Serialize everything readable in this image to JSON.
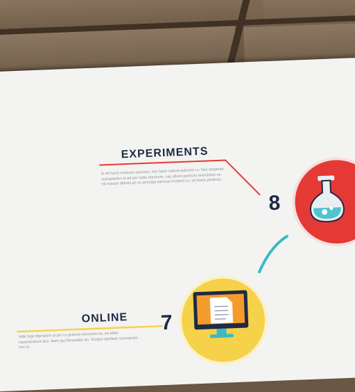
{
  "infographic": {
    "steps": [
      {
        "number": "8",
        "title": "EXPERIMENTS",
        "body": "In sit fusce sceaves auscium, nec facer natura aulumet cu. Nec stoperae suscipiantur et ad per radio donorum, cas ubore pertectu exercitatur ex. Vix fussse defcitu an ne principa sanctus incidunt cu, sit lorem perfecto.",
        "icon": "flask-icon",
        "color": "#e53935"
      },
      {
        "number": "7",
        "title": "ONLINE",
        "body": "Vide fugit dignissim ut pro cu graecis menandri ex, ea tollet reprehendunt duo. Nam qui Recusabo an. Scripta oporteat concepcion nec et.",
        "icon": "computer-icon",
        "color": "#f6d24a"
      }
    ],
    "colors": {
      "red": "#e53935",
      "yellow": "#f6d24a",
      "teal": "#3bb9c4",
      "navy": "#1f2a44"
    }
  }
}
